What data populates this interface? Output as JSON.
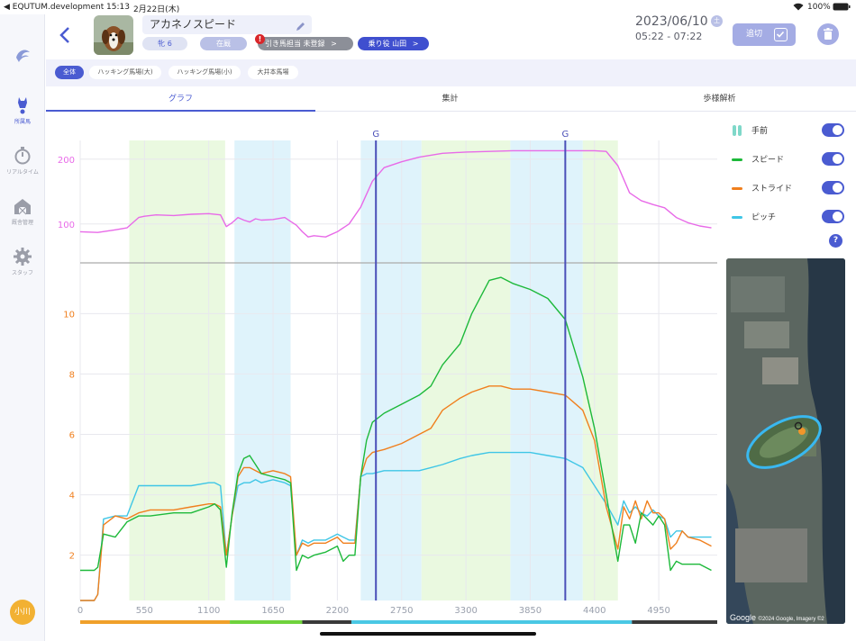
{
  "status_bar": {
    "back_app": "◀ EQUTUM.development",
    "time": "15:13",
    "date": "2月22日(木)",
    "battery": "100%"
  },
  "sidebar": {
    "items": [
      {
        "label": "所属馬",
        "icon": "horse-icon"
      },
      {
        "label": "リアルタイム",
        "icon": "stopwatch-icon"
      },
      {
        "label": "厩舎管理",
        "icon": "barn-icon"
      },
      {
        "label": "スタッフ",
        "icon": "gear-icon"
      }
    ],
    "user_initials": "小川"
  },
  "header": {
    "horse_name": "アカネノスピード",
    "sex_age": "牝 6",
    "status": "在厩",
    "handler_label": "引き馬担当",
    "handler_value": "未登録",
    "rider_label": "乗り役",
    "rider_value": "山田",
    "chevron": ">",
    "date": "2023/06/10",
    "day_of_week": "土",
    "time_range": "05:22 - 07:22",
    "add_label": "追切"
  },
  "filters": [
    "全体",
    "ハッキング馬場(大)",
    "ハッキング馬場(小)",
    "大井本馬場"
  ],
  "tabs": [
    "グラフ",
    "集計",
    "歩様解析"
  ],
  "legend": [
    {
      "label": "手前",
      "color": "#7fd8c9"
    },
    {
      "label": "スピード",
      "color": "#1db93a"
    },
    {
      "label": "ストライド",
      "color": "#f07f1d"
    },
    {
      "label": "ピッチ",
      "color": "#3fc6e6"
    }
  ],
  "map": {
    "credit_logo": "Google",
    "credit_text": "©2024 Google, Imagery ©2"
  },
  "chart_data": {
    "type": "line",
    "x_ticks": [
      0,
      550,
      1100,
      1650,
      2200,
      2750,
      3300,
      3850,
      4400,
      4950
    ],
    "xlim": [
      0,
      5450
    ],
    "top_panel": {
      "yticks": [
        100,
        200
      ],
      "ylim": [
        40,
        240
      ],
      "series": [
        {
          "color": "#e86ae8",
          "x": [
            0,
            150,
            300,
            400,
            500,
            550,
            650,
            800,
            950,
            1100,
            1200,
            1250,
            1300,
            1350,
            1400,
            1450,
            1500,
            1550,
            1650,
            1750,
            1800,
            1850,
            1900,
            1950,
            2000,
            2100,
            2200,
            2300,
            2400,
            2500,
            2600,
            2750,
            2900,
            3100,
            3300,
            3500,
            3700,
            3900,
            4100,
            4300,
            4400,
            4500,
            4600,
            4700,
            4800,
            4900,
            5000,
            5100,
            5200,
            5300,
            5400
          ],
          "y": [
            88,
            87,
            91,
            94,
            110,
            112,
            114,
            113,
            115,
            116,
            114,
            96,
            102,
            110,
            106,
            103,
            108,
            106,
            107,
            110,
            104,
            98,
            88,
            80,
            82,
            80,
            88,
            100,
            126,
            166,
            187,
            196,
            203,
            209,
            211,
            212,
            213,
            213,
            213,
            213,
            213,
            212,
            190,
            148,
            136,
            130,
            125,
            110,
            102,
            97,
            94
          ]
        }
      ]
    },
    "bottom_panel": {
      "yticks": [
        2,
        4,
        6,
        8,
        10
      ],
      "ylim": [
        0.5,
        11.5
      ],
      "series": [
        {
          "name": "スピード",
          "color": "#1db93a",
          "x": [
            0,
            120,
            150,
            200,
            300,
            400,
            500,
            600,
            800,
            950,
            1100,
            1150,
            1200,
            1250,
            1300,
            1350,
            1400,
            1450,
            1500,
            1550,
            1650,
            1750,
            1800,
            1850,
            1900,
            1950,
            2000,
            2100,
            2200,
            2250,
            2300,
            2350,
            2400,
            2450,
            2500,
            2600,
            2750,
            2900,
            3000,
            3100,
            3250,
            3350,
            3500,
            3600,
            3700,
            3850,
            4000,
            4150,
            4300,
            4400,
            4500,
            4600,
            4650,
            4700,
            4750,
            4800,
            4850,
            4900,
            4950,
            5000,
            5050,
            5100,
            5150,
            5200,
            5300,
            5400
          ],
          "y": [
            1.5,
            1.5,
            1.6,
            2.7,
            2.6,
            3.1,
            3.3,
            3.3,
            3.4,
            3.4,
            3.6,
            3.7,
            3.5,
            1.6,
            3.4,
            4.7,
            5.2,
            5.3,
            5.0,
            4.7,
            4.6,
            4.5,
            4.4,
            1.5,
            2.0,
            1.9,
            2.0,
            2.1,
            2.3,
            1.8,
            2.0,
            2.0,
            4.6,
            5.8,
            6.4,
            6.7,
            7.0,
            7.3,
            7.6,
            8.3,
            9.0,
            10.0,
            11.1,
            11.2,
            11.0,
            10.8,
            10.5,
            9.8,
            7.9,
            6.2,
            4.0,
            1.8,
            3.0,
            3.0,
            2.4,
            3.4,
            3.2,
            3.0,
            3.3,
            3.0,
            1.5,
            1.8,
            1.7,
            1.7,
            1.7,
            1.5
          ]
        },
        {
          "name": "ストライド",
          "color": "#f07f1d",
          "x": [
            0,
            120,
            150,
            200,
            300,
            400,
            500,
            600,
            800,
            950,
            1100,
            1150,
            1200,
            1250,
            1300,
            1350,
            1400,
            1450,
            1500,
            1550,
            1650,
            1750,
            1800,
            1850,
            1900,
            1950,
            2000,
            2100,
            2200,
            2250,
            2300,
            2350,
            2400,
            2450,
            2500,
            2600,
            2750,
            2900,
            3000,
            3100,
            3250,
            3350,
            3500,
            3600,
            3700,
            3850,
            4000,
            4150,
            4300,
            4400,
            4500,
            4600,
            4650,
            4700,
            4750,
            4800,
            4850,
            4900,
            4950,
            5000,
            5050,
            5100,
            5150,
            5200,
            5300,
            5400
          ],
          "y": [
            0.5,
            0.5,
            0.7,
            3.0,
            3.3,
            3.2,
            3.4,
            3.5,
            3.5,
            3.6,
            3.7,
            3.7,
            3.6,
            2.0,
            3.3,
            4.6,
            4.9,
            4.9,
            4.8,
            4.7,
            4.8,
            4.7,
            4.6,
            2.0,
            2.4,
            2.3,
            2.4,
            2.4,
            2.6,
            2.4,
            2.4,
            2.4,
            4.6,
            5.2,
            5.4,
            5.5,
            5.7,
            6.0,
            6.2,
            6.8,
            7.2,
            7.4,
            7.6,
            7.6,
            7.5,
            7.5,
            7.4,
            7.3,
            6.8,
            5.8,
            3.6,
            2.2,
            3.6,
            3.2,
            3.8,
            3.2,
            3.8,
            3.4,
            3.4,
            3.2,
            2.2,
            2.4,
            2.8,
            2.6,
            2.5,
            2.3
          ]
        },
        {
          "name": "ピッチ",
          "color": "#3fc6e6",
          "x": [
            0,
            120,
            150,
            200,
            300,
            400,
            500,
            600,
            800,
            950,
            1100,
            1150,
            1200,
            1250,
            1300,
            1350,
            1400,
            1450,
            1500,
            1550,
            1650,
            1750,
            1800,
            1850,
            1900,
            1950,
            2000,
            2100,
            2200,
            2250,
            2300,
            2350,
            2400,
            2450,
            2500,
            2600,
            2750,
            2900,
            3000,
            3100,
            3250,
            3350,
            3500,
            3600,
            3700,
            3850,
            4000,
            4150,
            4300,
            4400,
            4500,
            4600,
            4650,
            4700,
            4750,
            4800,
            4850,
            4900,
            4950,
            5000,
            5050,
            5100,
            5150,
            5200,
            5300,
            5400
          ],
          "y": [
            0.5,
            0.5,
            0.7,
            3.2,
            3.3,
            3.3,
            4.3,
            4.3,
            4.3,
            4.3,
            4.4,
            4.4,
            4.3,
            2.0,
            3.3,
            4.3,
            4.4,
            4.4,
            4.5,
            4.4,
            4.5,
            4.4,
            4.3,
            2.0,
            2.5,
            2.4,
            2.5,
            2.5,
            2.7,
            2.6,
            2.5,
            2.5,
            4.6,
            4.7,
            4.7,
            4.8,
            4.8,
            4.8,
            4.9,
            5.0,
            5.2,
            5.3,
            5.4,
            5.4,
            5.4,
            5.4,
            5.3,
            5.2,
            4.9,
            4.3,
            3.7,
            3.0,
            3.8,
            3.4,
            3.6,
            3.4,
            3.3,
            3.5,
            3.3,
            3.2,
            2.6,
            2.8,
            2.8,
            2.6,
            2.6,
            2.6
          ]
        }
      ]
    },
    "goal_lines": [
      {
        "x": 2530,
        "label": "G"
      },
      {
        "x": 4150,
        "label": "G"
      }
    ],
    "bands": [
      {
        "x0": 420,
        "x1": 1240,
        "color": "#eaf9e0"
      },
      {
        "x0": 1320,
        "x1": 1800,
        "color": "#dff3fb"
      },
      {
        "x0": 2400,
        "x1": 2920,
        "color": "#dff3fb"
      },
      {
        "x0": 2920,
        "x1": 3300,
        "color": "#eaf9e0"
      },
      {
        "x0": 3300,
        "x1": 3680,
        "color": "#eaf9e0"
      },
      {
        "x0": 3680,
        "x1": 4300,
        "color": "#dff3fb"
      },
      {
        "x0": 4300,
        "x1": 4600,
        "color": "#eaf9e0"
      }
    ],
    "bottom_bar": [
      {
        "x0": 0,
        "x1": 1280,
        "color": "#f0a02a"
      },
      {
        "x0": 1280,
        "x1": 1900,
        "color": "#6fd23c"
      },
      {
        "x0": 1900,
        "x1": 2320,
        "color": "#3a3a3a"
      },
      {
        "x0": 2320,
        "x1": 4720,
        "color": "#4ac8e4"
      },
      {
        "x0": 4720,
        "x1": 5450,
        "color": "#3a3a3a"
      }
    ]
  }
}
